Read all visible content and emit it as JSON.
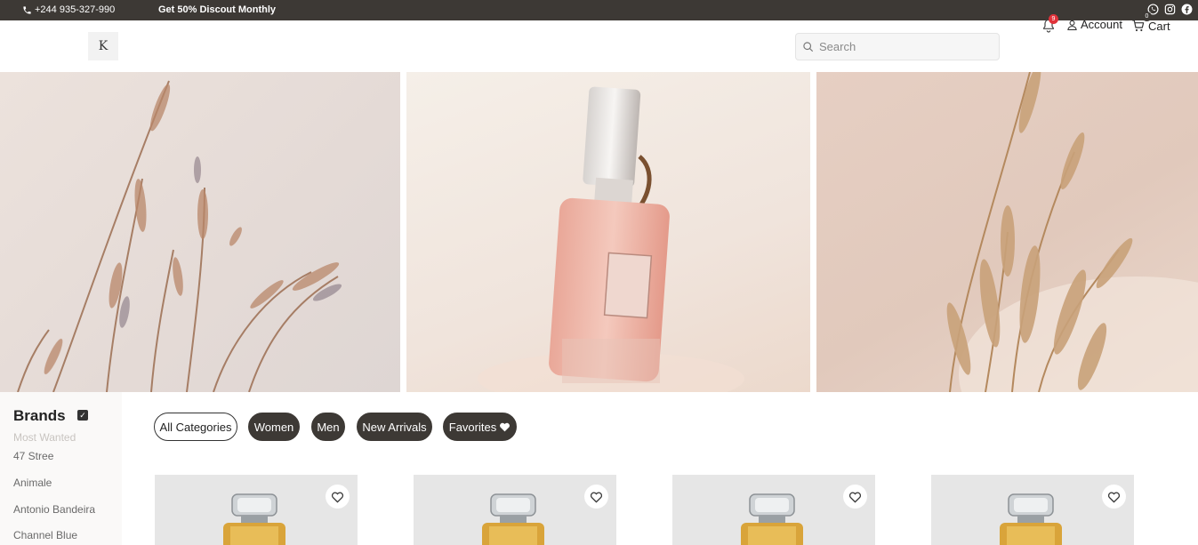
{
  "topbar": {
    "phone": "+244 935-327-990",
    "promo": "Get 50% Discout Monthly",
    "socials": [
      "whatsapp-icon",
      "instagram-icon",
      "facebook-icon"
    ]
  },
  "header": {
    "logo_text": "K",
    "search_placeholder": "Search",
    "notification_count": "9",
    "account_label": "Account",
    "cart_label": "Cart",
    "cart_count": "0"
  },
  "sidebar": {
    "title": "Brands",
    "subtitle": "Most Wanted",
    "items": [
      "47 Stree",
      "Animale",
      "Antonio Bandeira",
      "Channel Blue"
    ]
  },
  "categories": [
    {
      "label": "All Categories",
      "active": true
    },
    {
      "label": "Women",
      "active": false
    },
    {
      "label": "Men",
      "active": false
    },
    {
      "label": "New Arrivals",
      "active": false
    },
    {
      "label": "Favorites",
      "active": false,
      "icon": "heart-icon"
    }
  ],
  "colors": {
    "dark": "#3d3935",
    "badge_red": "#e0323a",
    "card_bg": "#e6e6e6"
  }
}
